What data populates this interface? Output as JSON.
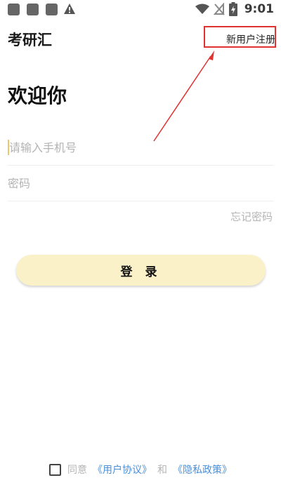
{
  "status_bar": {
    "time": "9:01",
    "icons": [
      "notification-square-icon",
      "notification-square-icon",
      "notification-square-icon",
      "warning-icon",
      "wifi-icon",
      "no-signal-icon",
      "battery-charging-icon"
    ]
  },
  "header": {
    "app_title": "考研汇",
    "register_link": "新用户注册"
  },
  "main": {
    "welcome": "欢迎你",
    "phone_placeholder": "请输入手机号",
    "password_placeholder": "密码",
    "forgot_password": "忘记密码",
    "login_button": "登 录"
  },
  "agreement": {
    "agree_text": "同意",
    "user_agreement": "《用户协议》",
    "and_text": "和",
    "privacy_policy": "《隐私政策》"
  },
  "colors": {
    "accent": "#faf1c9",
    "link": "#4a8fd9",
    "annotation": "#e0322f"
  }
}
